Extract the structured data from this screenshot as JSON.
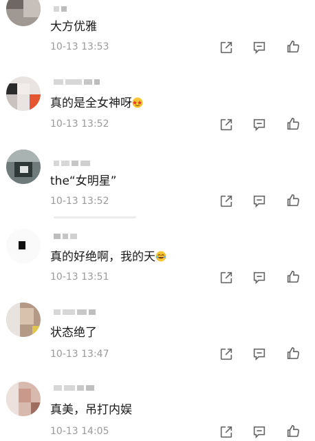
{
  "comments": [
    {
      "text": "大方优雅",
      "time": "10-13 13:53",
      "emoji": ""
    },
    {
      "text": "真的是全女神呀",
      "time": "10-13 13:52",
      "emoji": "star-struck-emoji"
    },
    {
      "text": "the“女明星”",
      "time": "10-13 13:52",
      "emoji": ""
    },
    {
      "text": "真的好绝啊，我的天",
      "time": "10-13 13:51",
      "emoji": "laughing-emoji"
    },
    {
      "text": "状态绝了",
      "time": "10-13 13:47",
      "emoji": ""
    },
    {
      "text": "真美，吊打内娱",
      "time": "10-13 14:05",
      "emoji": ""
    }
  ],
  "icons": {
    "share": "share-icon",
    "reply": "reply-icon",
    "like": "thumbs-up-icon"
  },
  "colors": {
    "text": "#1a1a1a",
    "meta": "#9a9a9a",
    "icon": "#666666"
  }
}
